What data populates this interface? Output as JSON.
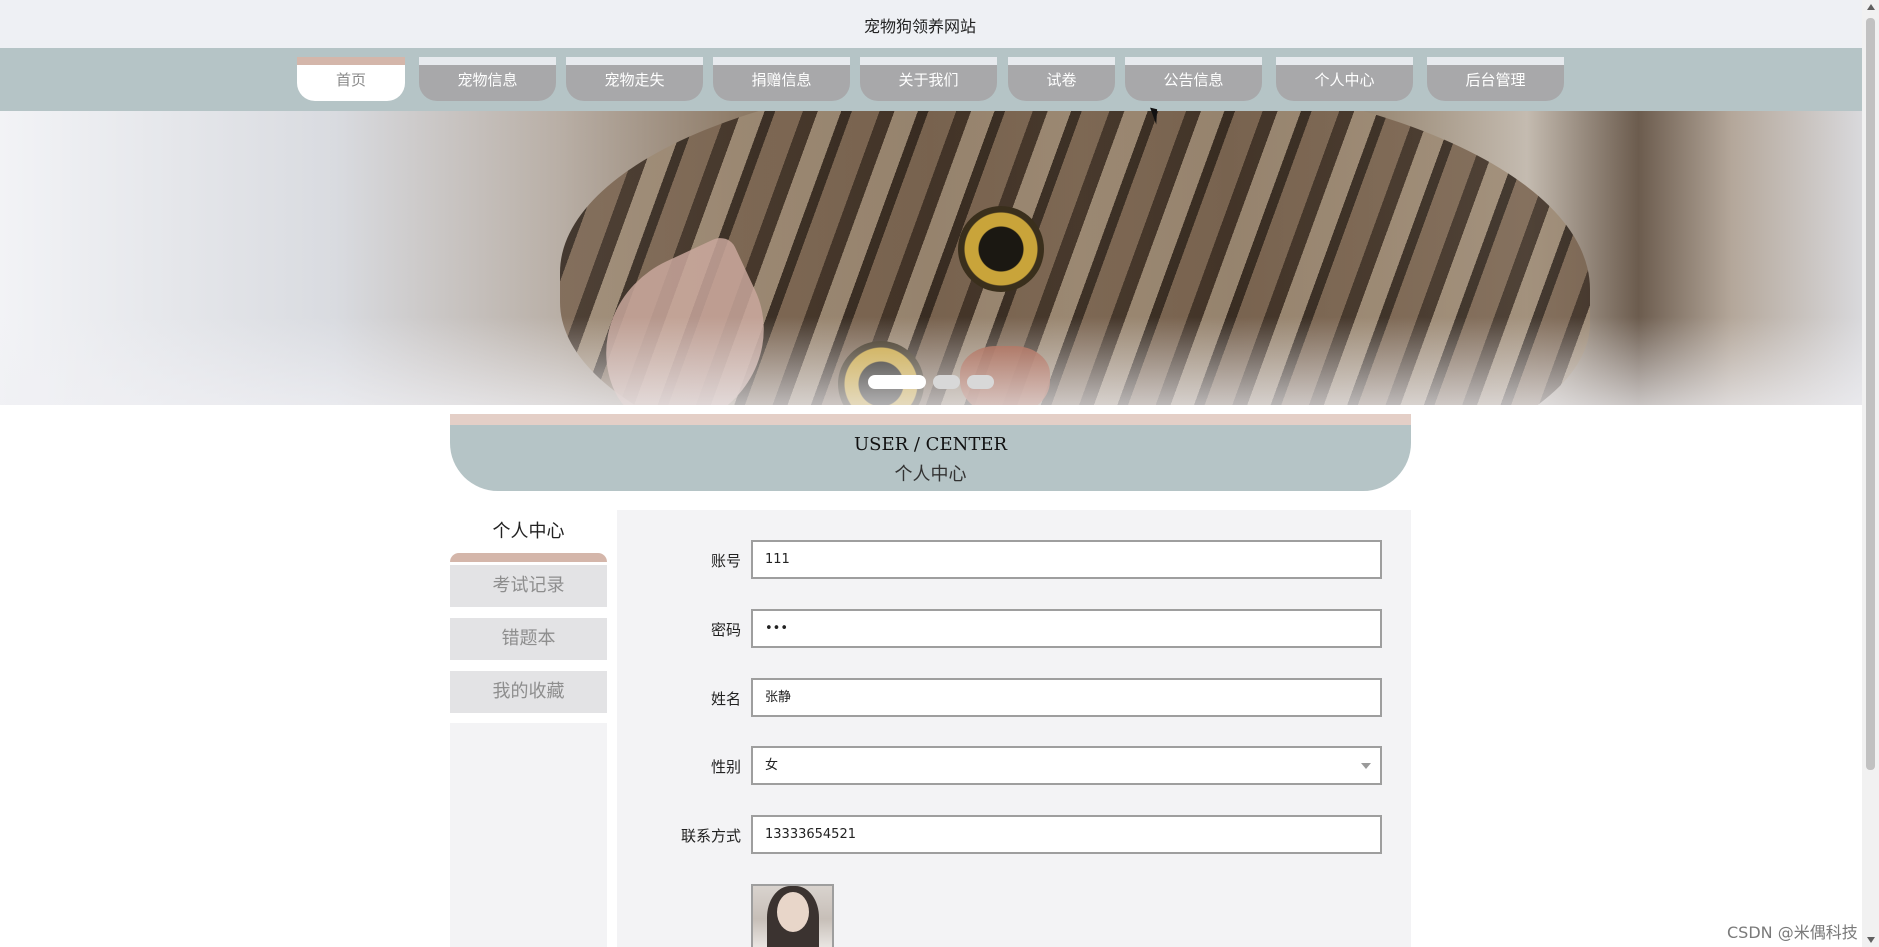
{
  "site": {
    "title": "宠物狗领养网站"
  },
  "nav": {
    "items": [
      {
        "label": "首页",
        "active": true
      },
      {
        "label": "宠物信息"
      },
      {
        "label": "宠物走失"
      },
      {
        "label": "捐赠信息"
      },
      {
        "label": "关于我们"
      },
      {
        "label": "试卷"
      },
      {
        "label": "公告信息"
      },
      {
        "label": "个人中心"
      },
      {
        "label": "后台管理"
      }
    ]
  },
  "banner": {
    "slides": 3,
    "active_slide": 1
  },
  "user_center": {
    "title_en": "USER / CENTER",
    "title_cn": "个人中心"
  },
  "sidebar": {
    "title": "个人中心",
    "items": [
      {
        "label": "考试记录"
      },
      {
        "label": "错题本"
      },
      {
        "label": "我的收藏"
      }
    ]
  },
  "form": {
    "fields": [
      {
        "label": "账号",
        "value": "111"
      },
      {
        "label": "密码",
        "value": "•••"
      },
      {
        "label": "姓名",
        "value": "张静"
      },
      {
        "label": "性别",
        "value": "女"
      },
      {
        "label": "联系方式",
        "value": "13333654521"
      }
    ]
  },
  "watermark": "CSDN @米偶科技",
  "colors": {
    "nav_bg": "#b5c4c6",
    "nav_tab": "#a8a8aa",
    "accent": "#d4b6aa",
    "panel_bg": "#f3f3f5"
  }
}
